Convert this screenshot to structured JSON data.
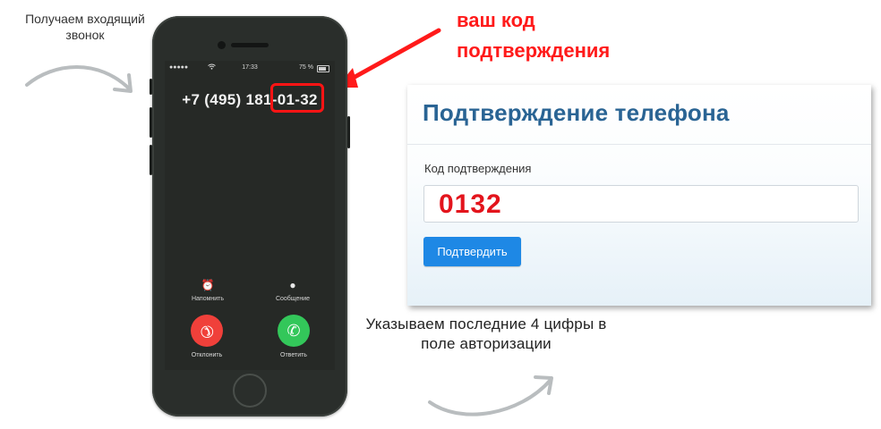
{
  "captions": {
    "incoming_call": "Получаем входящий звонок",
    "instruction": "Указываем последние 4 цифры в поле авторизации",
    "your_code": "ваш код подтверждения"
  },
  "phone": {
    "status_time": "17:33",
    "status_battery": "75 %",
    "caller_number": "+7 (495) 181-01-32",
    "actions": {
      "remind_label": "Напомнить",
      "message_label": "Сообщение",
      "decline_label": "Отклонить",
      "accept_label": "Ответить"
    }
  },
  "form": {
    "title": "Подтверждение телефона",
    "code_label": "Код подтверждения",
    "code_value": "0132",
    "submit_label": "Подтвердить"
  },
  "colors": {
    "annotation": "#ff1a1a",
    "title": "#2a6494",
    "button": "#1e88e5",
    "decline": "#f0403a",
    "accept": "#33c75a"
  },
  "icons": {
    "remind": "alarm-clock-icon",
    "message": "speech-bubble-icon",
    "decline": "phone-hangup-icon",
    "accept": "phone-icon",
    "wifi": "wifi-icon",
    "battery": "battery-icon"
  }
}
